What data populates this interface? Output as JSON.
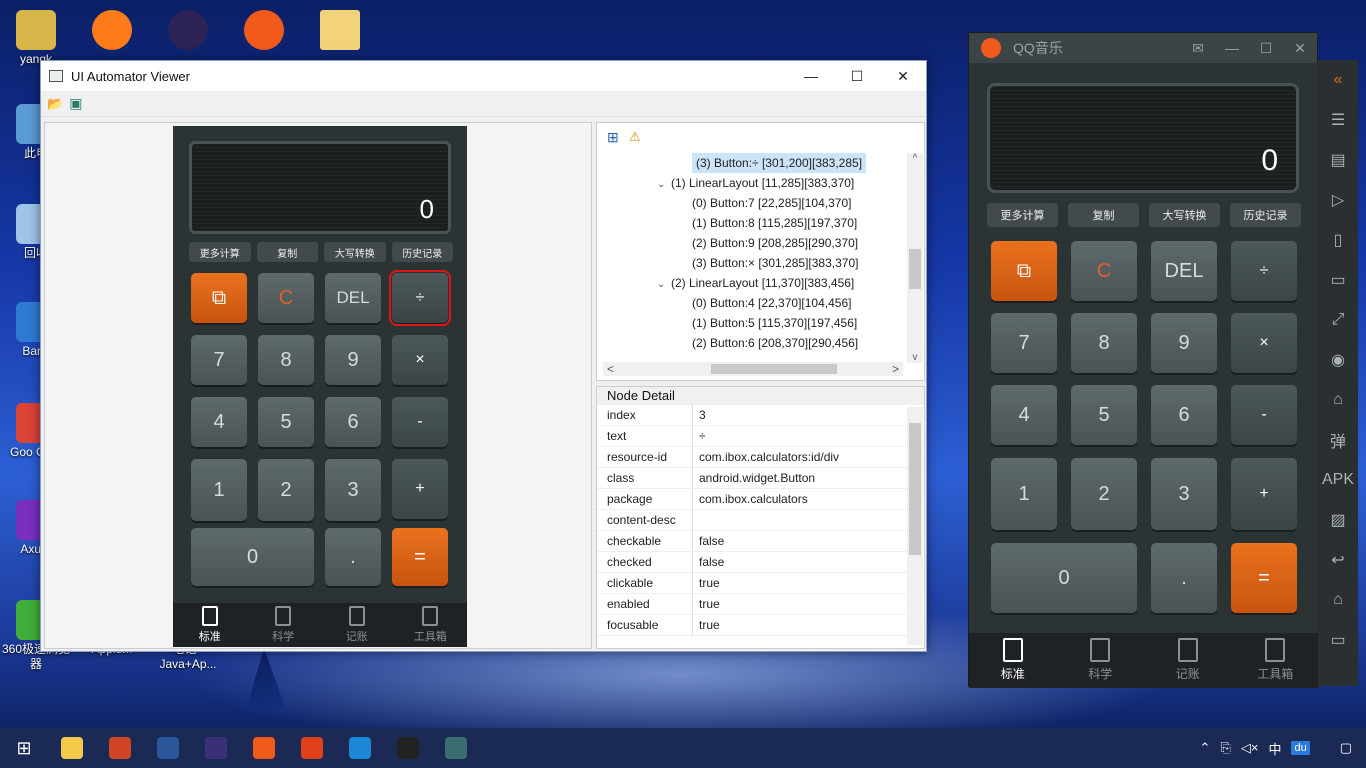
{
  "desktop": {
    "icons": [
      {
        "label": "yangk",
        "color": "#d8b548"
      },
      {
        "label": "此电",
        "color": "#5b9bd5"
      },
      {
        "label": "回收",
        "color": "#9ec4e8"
      },
      {
        "label": "Banc",
        "color": "#2e7bd6"
      },
      {
        "label": "Goo Chro",
        "color": "#db4437"
      },
      {
        "label": "Axure",
        "color": "#7b2fbf"
      },
      {
        "label": "360极速浏览器",
        "color": "#3fae3a"
      },
      {
        "label": "Appium",
        "color": "#7b4fd1"
      },
      {
        "label": "笔记 -Java+Ap...",
        "color": "#d8b548"
      }
    ],
    "top_icons": [
      {
        "name": "firefox",
        "color": "#ff7a18"
      },
      {
        "name": "eclipse",
        "color": "#2c2255"
      },
      {
        "name": "app-g",
        "color": "#f05a1a"
      },
      {
        "name": "folder",
        "color": "#f3d37a"
      }
    ]
  },
  "uia": {
    "title": "UI Automator Viewer",
    "min": "—",
    "max": "☐",
    "close": "✕",
    "toolbar": {
      "open": "📂",
      "device": "▣"
    },
    "phone": {
      "display": "0",
      "fn": [
        "更多计算",
        "复制",
        "大写转换",
        "历史记录"
      ],
      "keys": {
        "box": "⧉",
        "c": "C",
        "del": "DEL",
        "div": "÷",
        "k7": "7",
        "k8": "8",
        "k9": "9",
        "mul": "×",
        "k4": "4",
        "k5": "5",
        "k6": "6",
        "minus": "-",
        "k1": "1",
        "k2": "2",
        "k3": "3",
        "plus": "+",
        "k0": "0",
        "dot": ".",
        "eq": "="
      },
      "tabs": [
        "标准",
        "科学",
        "记账",
        "工具箱"
      ]
    },
    "tree": {
      "expand": "⊞",
      "warn": "⚠",
      "rows": [
        "(3) Button:÷ [301,200][383,285]",
        "(1) LinearLayout [11,285][383,370]",
        "(0) Button:7 [22,285][104,370]",
        "(1) Button:8 [115,285][197,370]",
        "(2) Button:9 [208,285][290,370]",
        "(3) Button:× [301,285][383,370]",
        "(2) LinearLayout [11,370][383,456]",
        "(0) Button:4 [22,370][104,456]",
        "(1) Button:5 [115,370][197,456]",
        "(2) Button:6 [208,370][290,456]"
      ],
      "scroll_left": "<",
      "scroll_right": ">",
      "scroll_up": "^",
      "scroll_down": "v"
    },
    "detail": {
      "title": "Node Detail",
      "rows": [
        {
          "k": "index",
          "v": "3"
        },
        {
          "k": "text",
          "v": "÷"
        },
        {
          "k": "resource-id",
          "v": "com.ibox.calculators:id/div"
        },
        {
          "k": "class",
          "v": "android.widget.Button"
        },
        {
          "k": "package",
          "v": "com.ibox.calculators"
        },
        {
          "k": "content-desc",
          "v": ""
        },
        {
          "k": "checkable",
          "v": "false"
        },
        {
          "k": "checked",
          "v": "false"
        },
        {
          "k": "clickable",
          "v": "true"
        },
        {
          "k": "enabled",
          "v": "true"
        },
        {
          "k": "focusable",
          "v": "true"
        }
      ]
    }
  },
  "qq": {
    "title": "QQ音乐",
    "display": "0",
    "fn": [
      "更多计算",
      "复制",
      "大写转换",
      "历史记录"
    ],
    "keys": {
      "box": "⧉",
      "c": "C",
      "del": "DEL",
      "div": "÷",
      "k7": "7",
      "k8": "8",
      "k9": "9",
      "mul": "×",
      "k4": "4",
      "k5": "5",
      "k6": "6",
      "minus": "-",
      "k1": "1",
      "k2": "2",
      "k3": "3",
      "plus": "+",
      "k0": "0",
      "dot": ".",
      "eq": "="
    },
    "tabs": [
      "标准",
      "科学",
      "记账",
      "工具箱"
    ],
    "side": [
      "«",
      "☰",
      "▤",
      "▷",
      "▯",
      "▭",
      "⤢",
      "◉",
      "⌂",
      "弹",
      "APK",
      "▨",
      "↩",
      "⌂",
      "▭"
    ]
  },
  "taskbar": {
    "apps": [
      {
        "name": "explorer",
        "color": "#f3c94a"
      },
      {
        "name": "powerpoint",
        "color": "#d04423"
      },
      {
        "name": "word",
        "color": "#2b579a"
      },
      {
        "name": "eclipse",
        "color": "#3b2f78"
      },
      {
        "name": "app-g",
        "color": "#f05a1a"
      },
      {
        "name": "app-g2",
        "color": "#e0401a"
      },
      {
        "name": "edge",
        "color": "#1b87d6"
      },
      {
        "name": "terminal",
        "color": "#222"
      },
      {
        "name": "uia",
        "color": "#3a6e6e"
      }
    ],
    "tray": {
      "up": "⌃",
      "ime": "中",
      "du": "du",
      "notify": "▢"
    }
  }
}
